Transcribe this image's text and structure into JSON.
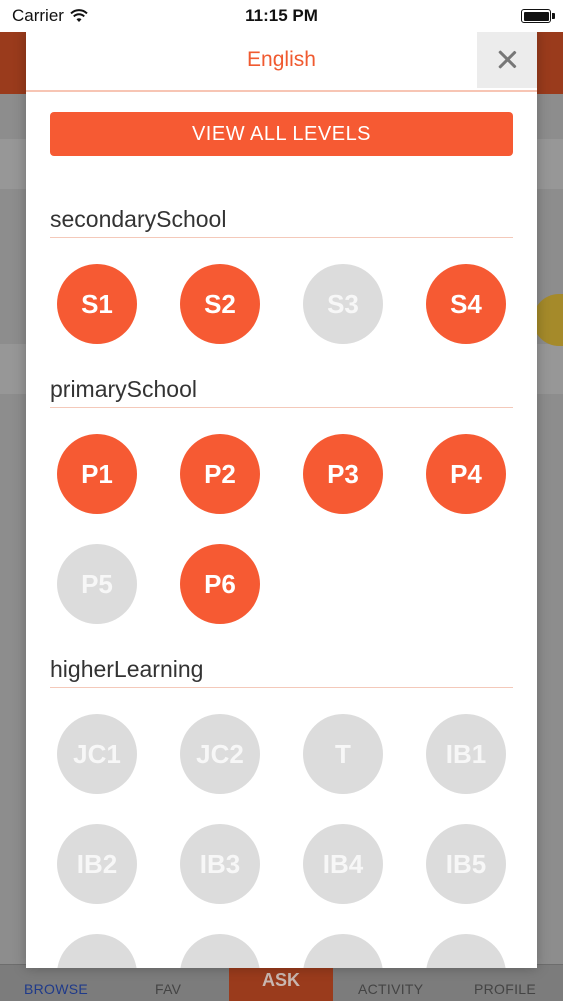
{
  "status_bar": {
    "carrier": "Carrier",
    "time": "11:15 PM"
  },
  "modal": {
    "title": "English",
    "view_all_label": "VIEW ALL LEVELS"
  },
  "sections": [
    {
      "title": "secondarySchool",
      "levels": [
        {
          "label": "S1",
          "active": true
        },
        {
          "label": "S2",
          "active": true
        },
        {
          "label": "S3",
          "active": false
        },
        {
          "label": "S4",
          "active": true
        }
      ]
    },
    {
      "title": "primarySchool",
      "levels": [
        {
          "label": "P1",
          "active": true
        },
        {
          "label": "P2",
          "active": true
        },
        {
          "label": "P3",
          "active": true
        },
        {
          "label": "P4",
          "active": true
        },
        {
          "label": "P5",
          "active": false
        },
        {
          "label": "P6",
          "active": true
        }
      ]
    },
    {
      "title": "higherLearning",
      "levels": [
        {
          "label": "JC1",
          "active": false
        },
        {
          "label": "JC2",
          "active": false
        },
        {
          "label": "T",
          "active": false
        },
        {
          "label": "IB1",
          "active": false
        },
        {
          "label": "IB2",
          "active": false
        },
        {
          "label": "IB3",
          "active": false
        },
        {
          "label": "IB4",
          "active": false
        },
        {
          "label": "IB5",
          "active": false
        },
        {
          "label": "",
          "active": false
        },
        {
          "label": "",
          "active": false
        },
        {
          "label": "",
          "active": false
        },
        {
          "label": "",
          "active": false
        }
      ]
    }
  ],
  "tab_bar": {
    "browse": "BROWSE",
    "fav": "FAV",
    "ask": "ASK",
    "activity": "ACTIVITY",
    "profile": "PROFILE"
  },
  "colors": {
    "accent": "#f65a33",
    "inactive": "#dcdcdc",
    "header_bg": "#9a3b1c",
    "tab_active": "#1f3a8a"
  }
}
